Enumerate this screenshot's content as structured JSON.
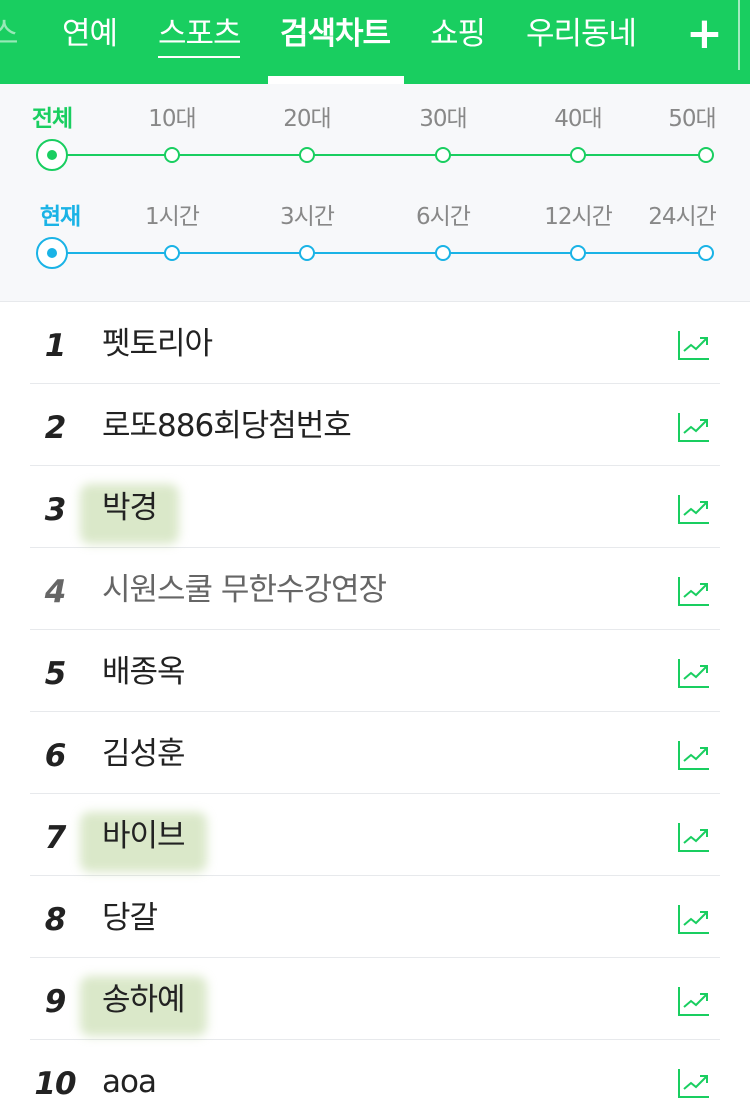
{
  "nav": {
    "partial_tab": "스",
    "tabs": [
      {
        "label": "연예"
      },
      {
        "label": "스포츠"
      },
      {
        "label": "검색차트",
        "active": true
      },
      {
        "label": "쇼핑"
      },
      {
        "label": "우리동네"
      }
    ],
    "more_icon": "plus-icon"
  },
  "filters": {
    "age": {
      "labels": [
        "전체",
        "10대",
        "20대",
        "30대",
        "40대",
        "50대"
      ],
      "selected": "전체"
    },
    "time": {
      "labels": [
        "현재",
        "1시간",
        "3시간",
        "6시간",
        "12시간",
        "24시간"
      ],
      "selected": "현재"
    }
  },
  "ranking": [
    {
      "rank": "1",
      "keyword": "펫토리아"
    },
    {
      "rank": "2",
      "keyword": "로또886회당첨번호"
    },
    {
      "rank": "3",
      "keyword": "박경"
    },
    {
      "rank": "4",
      "keyword": "시원스쿨 무한수강연장"
    },
    {
      "rank": "5",
      "keyword": "배종옥"
    },
    {
      "rank": "6",
      "keyword": "김성훈"
    },
    {
      "rank": "7",
      "keyword": "바이브"
    },
    {
      "rank": "8",
      "keyword": "당갈"
    },
    {
      "rank": "9",
      "keyword": "송하예"
    },
    {
      "rank": "10",
      "keyword": "aoa"
    }
  ],
  "trend_icon": "trend-chart-icon",
  "colors": {
    "brand_green": "#19ce60",
    "time_blue": "#1ab3e6"
  }
}
